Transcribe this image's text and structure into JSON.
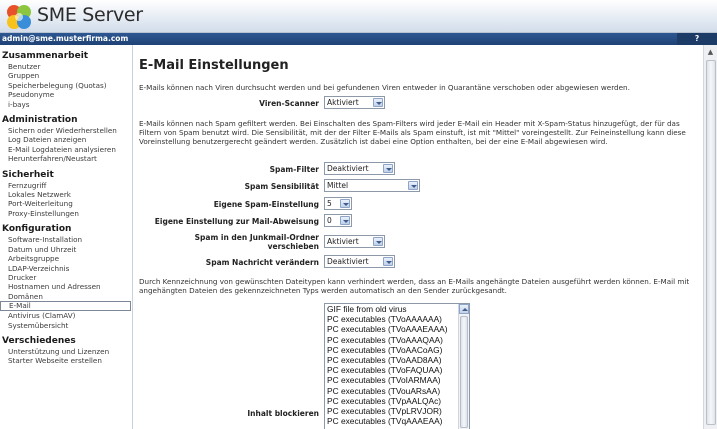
{
  "app": {
    "title": "SME Server"
  },
  "userbar": {
    "user": "admin@sme.musterfirma.com",
    "help": "?"
  },
  "sidebar": {
    "groups": [
      {
        "heading": "Zusammenarbeit",
        "items": [
          "Benutzer",
          "Gruppen",
          "Speicherbelegung (Quotas)",
          "Pseudonyme",
          "i-bays"
        ]
      },
      {
        "heading": "Administration",
        "items": [
          "Sichern oder Wiederherstellen",
          "Log Dateien anzeigen",
          "E-Mail Logdateien analysieren",
          "Herunterfahren/Neustart"
        ]
      },
      {
        "heading": "Sicherheit",
        "items": [
          "Fernzugriff",
          "Lokales Netzwerk",
          "Port-Weiterleitung",
          "Proxy-Einstellungen"
        ]
      },
      {
        "heading": "Konfiguration",
        "items": [
          "Software-Installation",
          "Datum und Uhrzeit",
          "Arbeitsgruppe",
          "LDAP-Verzeichnis",
          "Drucker",
          "Hostnamen und Adressen",
          "Domänen",
          "E-Mail",
          "Antivirus (ClamAV)",
          "Systemübersicht"
        ]
      },
      {
        "heading": "Verschiedenes",
        "items": [
          "Unterstützung und Lizenzen",
          "Starter Webseite erstellen"
        ]
      }
    ],
    "active": "E-Mail"
  },
  "main": {
    "title": "E-Mail Einstellungen",
    "intro_virus": "E-Mails können nach Viren durchsucht werden und bei gefundenen Viren entweder in Quarantäne verschoben oder abgewiesen werden.",
    "intro_spam": "E-Mails können nach Spam gefiltert werden. Bei Einschalten des Spam-Filters wird jeder E-Mail ein Header mit X-Spam-Status hinzugefügt, der für das Filtern von Spam benutzt wird. Die Sensibilität, mit der der Filter E-Mails als Spam einstuft, ist mit \"Mittel\" voreingestellt. Zur Feineinstellung kann diese Voreinstellung benutzergerecht geändert werden. Zusätzlich ist dabei eine Option enthalten, bei der eine E-Mail abgewiesen wird.",
    "intro_block": "Durch Kennzeichnung von gewünschten Dateitypen kann verhindert werden, dass an E-Mails angehängte Dateien ausgeführt werden können. E-Mail mit angehängten Dateien des gekennzeichneten Typs werden automatisch an den Sender zurückgesandt.",
    "fields": {
      "virus_scanner": {
        "label": "Viren-Scanner",
        "value": "Aktiviert"
      },
      "spam_filter": {
        "label": "Spam-Filter",
        "value": "Deaktiviert"
      },
      "spam_sensitivity": {
        "label": "Spam Sensibilität",
        "value": "Mittel"
      },
      "own_spam": {
        "label": "Eigene Spam-Einstellung",
        "value": "5"
      },
      "own_reject": {
        "label": "Eigene Einstellung zur Mail-Abweisung",
        "value": "0"
      },
      "junkmail_line1": "Spam in den Junkmail-Ordner",
      "junkmail_line2": "verschieben",
      "junkmail_value": "Aktiviert",
      "modify_message": {
        "label": "Spam Nachricht verändern",
        "value": "Deaktiviert"
      },
      "block_content": {
        "label": "Inhalt blockieren"
      }
    },
    "block_options": [
      "GIF file from old virus",
      "PC executables (TVoAAAAAA)",
      "PC executables (TVoAAAEAAA)",
      "PC executables (TVoAAAQAA)",
      "PC executables (TVoAACoAG)",
      "PC executables (TVoAAD8AA)",
      "PC executables (TVoFAQUAA)",
      "PC executables (TVoIARMAA)",
      "PC executables (TVouARsAA)",
      "PC executables (TVpAALQAc)",
      "PC executables (TVpLRVJOR)",
      "PC executables (TVqAAAEAA)"
    ]
  },
  "colors": {
    "header_bar": "#1f4275",
    "accent": "#2d5792"
  }
}
